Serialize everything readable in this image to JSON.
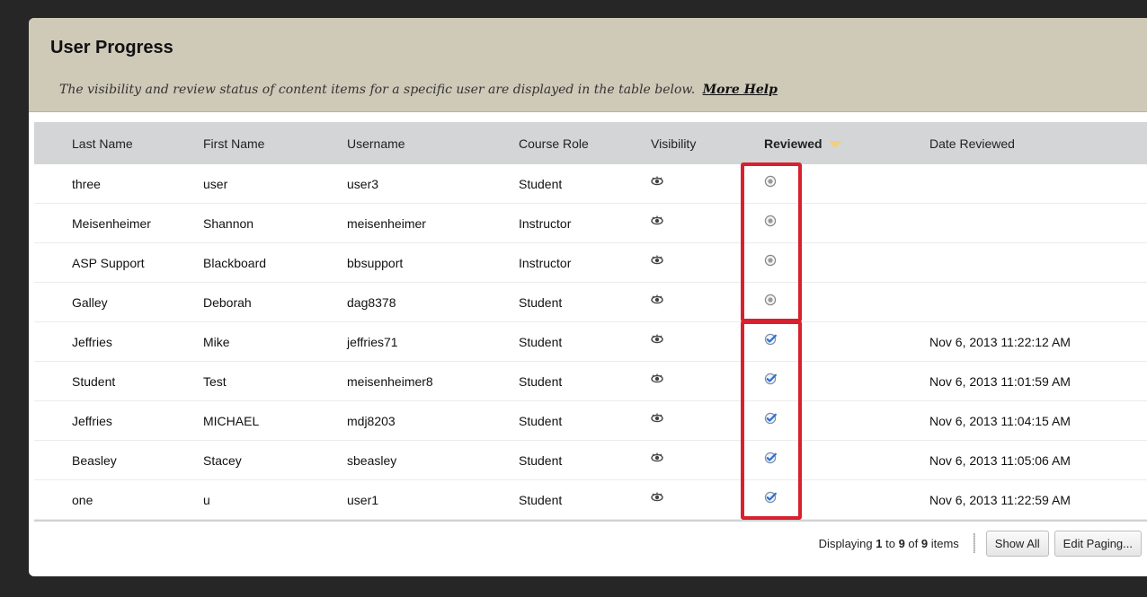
{
  "page": {
    "title": "User Progress",
    "description": "The visibility and review status of content items for a specific user are displayed in the table below.",
    "help_link": "More Help"
  },
  "table": {
    "columns": [
      "Last Name",
      "First Name",
      "Username",
      "Course Role",
      "Visibility",
      "Reviewed",
      "Date Reviewed"
    ],
    "sorted_column": "Reviewed",
    "rows": [
      {
        "last_name": "three",
        "first_name": "user",
        "username": "user3",
        "role": "Student",
        "visibility": "visible",
        "reviewed": "not-reviewed",
        "date": ""
      },
      {
        "last_name": "Meisenheimer",
        "first_name": "Shannon",
        "username": "meisenheimer",
        "role": "Instructor",
        "visibility": "visible",
        "reviewed": "not-reviewed",
        "date": ""
      },
      {
        "last_name": "ASP Support",
        "first_name": "Blackboard",
        "username": "bbsupport",
        "role": "Instructor",
        "visibility": "visible",
        "reviewed": "not-reviewed",
        "date": ""
      },
      {
        "last_name": "Galley",
        "first_name": "Deborah",
        "username": "dag8378",
        "role": "Student",
        "visibility": "visible",
        "reviewed": "not-reviewed",
        "date": ""
      },
      {
        "last_name": "Jeffries",
        "first_name": "Mike",
        "username": "jeffries71",
        "role": "Student",
        "visibility": "visible",
        "reviewed": "reviewed",
        "date": "Nov 6, 2013 11:22:12 AM"
      },
      {
        "last_name": "Student",
        "first_name": "Test",
        "username": "meisenheimer8",
        "role": "Student",
        "visibility": "visible",
        "reviewed": "reviewed",
        "date": "Nov 6, 2013 11:01:59 AM"
      },
      {
        "last_name": "Jeffries",
        "first_name": "MICHAEL",
        "username": "mdj8203",
        "role": "Student",
        "visibility": "visible",
        "reviewed": "reviewed",
        "date": "Nov 6, 2013 11:04:15 AM"
      },
      {
        "last_name": "Beasley",
        "first_name": "Stacey",
        "username": "sbeasley",
        "role": "Student",
        "visibility": "visible",
        "reviewed": "reviewed",
        "date": "Nov 6, 2013 11:05:06 AM"
      },
      {
        "last_name": "one",
        "first_name": "u",
        "username": "user1",
        "role": "Student",
        "visibility": "visible",
        "reviewed": "reviewed",
        "date": "Nov 6, 2013 11:22:59 AM"
      }
    ]
  },
  "paging": {
    "prefix": "Displaying ",
    "from": "1",
    "to_label": " to ",
    "to": "9",
    "of_label": " of ",
    "total": "9",
    "suffix": " items",
    "show_all": "Show All",
    "edit_paging": "Edit Paging..."
  },
  "colors": {
    "header_bg": "#cfc9b8",
    "table_header_bg": "#d3d5d7",
    "highlight": "#d9202e",
    "reviewed_check": "#2f6fd0"
  },
  "icons": {
    "visibility": "eye-icon",
    "not_reviewed": "unchecked-circle-icon",
    "reviewed": "check-circle-icon",
    "sort": "sort-down-icon"
  }
}
